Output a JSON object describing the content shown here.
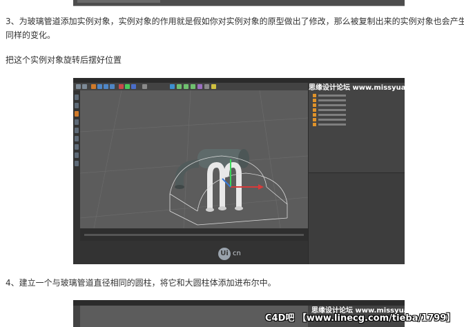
{
  "article": {
    "step3_line1": "3、为玻璃管道添加实例对象，实例对象的作用就是假如你对实例对象的原型做出了修改，那么被复制出来的实例对象也会产生",
    "step3_line2": "同样的变化。",
    "caption": "把这个实例对象旋转后摆好位置",
    "step4": "4、建立一个与玻璃管道直径相同的圆柱，将它和大圆柱体添加进布尔中。"
  },
  "screenshot1": {
    "watermark": "思缘设计论坛 www.missyuan.com",
    "logo_mark": "Ui",
    "logo_text": "cn"
  },
  "screenshot2": {
    "watermark": "思缘设计论坛 www.missyuan.com"
  },
  "footer_watermark": "C4D吧 【www.linecg.com/tieba/1799】",
  "colors": {
    "c4d_bg": "#3a3a3a",
    "viewport": "#5c5c5c",
    "pipe_highlight": "#e8e8e8",
    "axis_red": "#d83a3a",
    "axis_blue": "#3a7ad8",
    "axis_green": "#3ad85a"
  }
}
